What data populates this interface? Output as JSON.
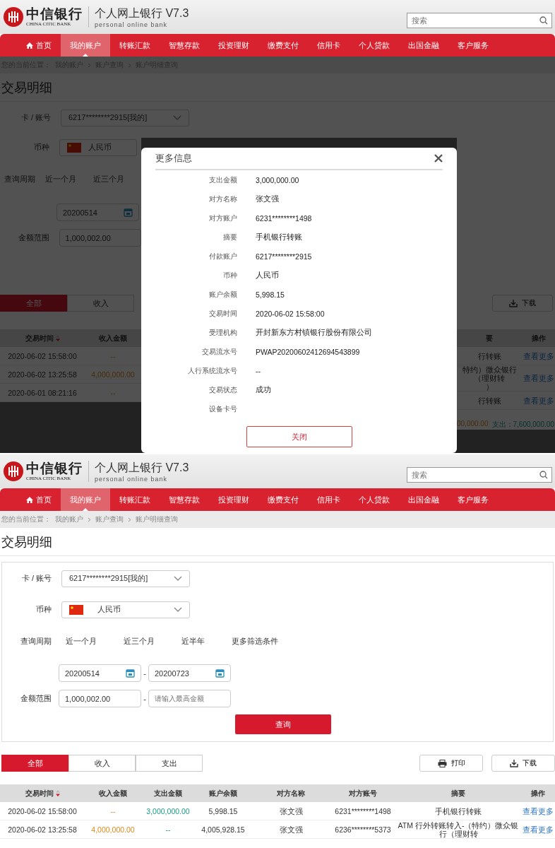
{
  "top_screen": {
    "header": {
      "logo_cn": "中信银行",
      "logo_en": "CHINA CITIC BANK",
      "title": "个人网上银行 V7.3",
      "subtitle": "personal online bank",
      "search_placeholder": "搜索"
    },
    "nav": [
      {
        "kind": "home",
        "label": "首页",
        "selected": false
      },
      {
        "kind": "text",
        "label": "我的账户",
        "selected": true
      },
      {
        "kind": "text",
        "label": "转账汇款",
        "selected": false
      },
      {
        "kind": "text",
        "label": "智慧存款",
        "selected": false
      },
      {
        "kind": "text",
        "label": "投资理财",
        "selected": false
      },
      {
        "kind": "text",
        "label": "缴费支付",
        "selected": false
      },
      {
        "kind": "text",
        "label": "信用卡",
        "selected": false
      },
      {
        "kind": "text",
        "label": "个人贷款",
        "selected": false
      },
      {
        "kind": "text",
        "label": "出国金融",
        "selected": false
      },
      {
        "kind": "text",
        "label": "客户服务",
        "selected": false
      }
    ],
    "breadcrumb": {
      "prefix": "您的当前位置：",
      "items": [
        "我的账户",
        "账户查询",
        "账户明细查询"
      ]
    },
    "page_title": "交易明细",
    "account": {
      "label": "卡 / 账号",
      "value": "6217********2915[我的]"
    },
    "left": {
      "currency": {
        "label": "币种",
        "value": "人民币"
      },
      "period": {
        "label": "查询周期",
        "options": [
          "近一个月",
          "近三个月"
        ]
      },
      "start_date": "20200514",
      "amount": {
        "label": "金额范围",
        "min": "1,000,002.00"
      },
      "tabs": [
        {
          "label": "全部",
          "selected": true
        },
        {
          "label": "收入",
          "selected": false
        }
      ],
      "columns": [
        "交易时间",
        "收入金额"
      ],
      "rows": [
        [
          "2020-06-02 15:58:00",
          "--"
        ],
        [
          "2020-06-02 13:25:58",
          "4,000,000.00"
        ],
        [
          "2020-06-01 08:21:16",
          "--"
        ]
      ]
    },
    "dialog": {
      "title": "更多信息",
      "fields": [
        {
          "label": "支出金额",
          "value": "3,000,000.00"
        },
        {
          "label": "对方名称",
          "value": "张文强"
        },
        {
          "label": "对方账户",
          "value": "6231********1498"
        },
        {
          "label": "摘要",
          "value": "手机银行转账"
        },
        {
          "label": "付款账户",
          "value": "6217********2915"
        },
        {
          "label": "币种",
          "value": "人民币"
        },
        {
          "label": "账户余额",
          "value": "5,998.15"
        },
        {
          "label": "交易时间",
          "value": "2020-06-02 15:58:00"
        },
        {
          "label": "受理机构",
          "value": "开封新东方村镇银行股份有限公司"
        },
        {
          "label": "交易流水号",
          "value": "PWAP20200602412694543899"
        },
        {
          "label": "人行系统流水号",
          "value": "--"
        },
        {
          "label": "交易状态",
          "value": "成功"
        },
        {
          "label": "设备卡号"
        }
      ],
      "button": "关闭"
    },
    "right": {
      "download": "下载",
      "columns": [
        "要",
        "操作"
      ],
      "rows": [
        {
          "summary_lines": [
            "行转账"
          ],
          "action": "查看更多"
        },
        {
          "summary_lines": [
            "特约）微众银行（理财转",
            "）"
          ],
          "action": "查看更多"
        },
        {
          "summary_lines": [
            "行转账"
          ],
          "action": "查看更多"
        }
      ],
      "income_total": "00,000.00",
      "expense_total": "支出：7,600,000.00"
    }
  },
  "bottom_screen": {
    "header": {
      "logo_cn": "中信银行",
      "logo_en": "CHINA CITIC BANK",
      "title": "个人网上银行 V7.3",
      "subtitle": "personal online bank",
      "search_placeholder": "搜索"
    },
    "nav": [
      {
        "kind": "home",
        "label": "首页",
        "selected": false
      },
      {
        "kind": "text",
        "label": "我的账户",
        "selected": true
      },
      {
        "kind": "text",
        "label": "转账汇款",
        "selected": false
      },
      {
        "kind": "text",
        "label": "智慧存款",
        "selected": false
      },
      {
        "kind": "text",
        "label": "投资理财",
        "selected": false
      },
      {
        "kind": "text",
        "label": "缴费支付",
        "selected": false
      },
      {
        "kind": "text",
        "label": "信用卡",
        "selected": false
      },
      {
        "kind": "text",
        "label": "个人贷款",
        "selected": false
      },
      {
        "kind": "text",
        "label": "出国金融",
        "selected": false
      },
      {
        "kind": "text",
        "label": "客户服务",
        "selected": false
      }
    ],
    "breadcrumb": {
      "prefix": "您的当前位置：",
      "items": [
        "我的账户",
        "账户查询",
        "账户明细查询"
      ]
    },
    "page_title": "交易明细",
    "account": {
      "label": "卡 / 账号",
      "value": "6217********2915[我的]"
    },
    "currency": {
      "label": "币种",
      "value": "人民币"
    },
    "period": {
      "label": "查询周期",
      "options": [
        "近一个月",
        "近三个月",
        "近半年",
        "更多筛选条件"
      ]
    },
    "dates": {
      "start": "20200514",
      "separator": "-",
      "end": "20200723"
    },
    "amount": {
      "label": "金额范围",
      "min": "1,000,002.00",
      "separator": "-",
      "max_placeholder": "请输入最高金额"
    },
    "query_button": "查询",
    "tabs": [
      {
        "label": "全部",
        "selected": true
      },
      {
        "label": "收入",
        "selected": false
      },
      {
        "label": "支出",
        "selected": false
      }
    ],
    "print": "打印",
    "download": "下载",
    "columns": [
      "交易时间",
      "收入金额",
      "支出金额",
      "账户余额",
      "对方名称",
      "对方账号",
      "摘要",
      "操作"
    ],
    "rows": [
      [
        "2020-06-02 15:58:00",
        "--",
        "3,000,000.00",
        "5,998.15",
        "张文强",
        "6231********1498",
        "手机银行转账",
        "查看更多"
      ],
      [
        "2020-06-02 13:25:58",
        "4,000,000.00",
        "--",
        "4,005,928.15",
        "张文强",
        "6236********5373",
        "ATM 行外转账转入-（特约）微众银行（理财转",
        "查看更多"
      ]
    ]
  }
}
